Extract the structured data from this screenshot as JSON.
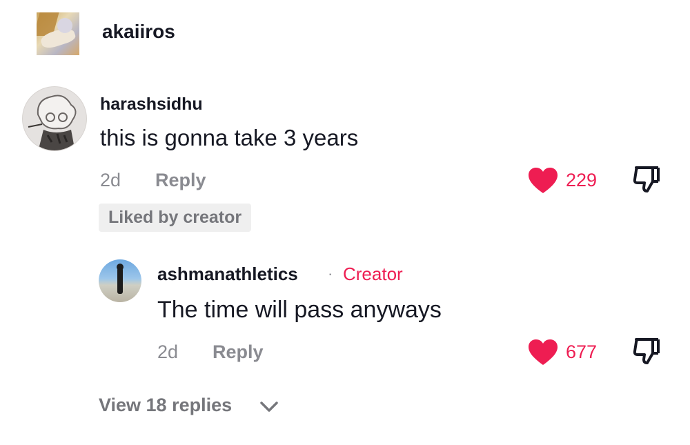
{
  "previous_comment": {
    "username": "akaiiros"
  },
  "comment": {
    "username": "harashsidhu",
    "text": "this is gonna take 3 years",
    "date": "2d",
    "reply_label": "Reply",
    "likes": "229",
    "liked_badge": "Liked by creator"
  },
  "reply": {
    "username": "ashmanathletics",
    "separator": "·",
    "creator_label": "Creator",
    "text": "The time will pass anyways",
    "date": "2d",
    "reply_label": "Reply",
    "likes": "677"
  },
  "view_replies_label": "View 18 replies",
  "colors": {
    "accent": "#ee1d52",
    "muted_text": "#8a8b91",
    "badge_bg": "#efefef"
  },
  "icons": [
    "heart-icon",
    "dislike-icon",
    "chevron-down-icon"
  ]
}
